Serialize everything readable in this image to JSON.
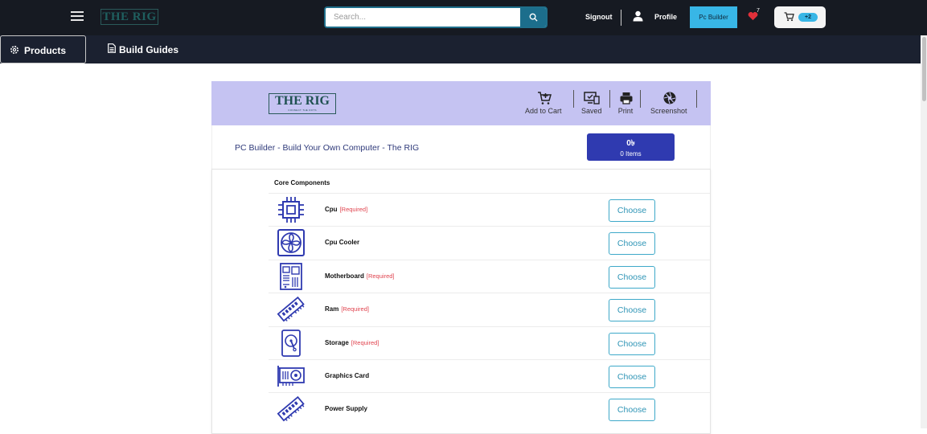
{
  "header": {
    "logo_text": "THE RIG",
    "search": {
      "placeholder": "Search..."
    },
    "signout_label": "Signout",
    "profile_label": "Profile",
    "pc_builder_label": "Pc Builder",
    "wishlist_count": "7",
    "cart_badge": "+2"
  },
  "nav": {
    "products_label": "Products",
    "build_guides_label": "Build Guides"
  },
  "builder": {
    "logo_text": "THE RIG",
    "logo_tagline": "CONNECT THE DOTS",
    "tools": [
      {
        "label": "Add to Cart",
        "icon": "cart-plus-icon"
      },
      {
        "label": "Saved",
        "icon": "saved-devices-icon"
      },
      {
        "label": "Print",
        "icon": "printer-icon"
      },
      {
        "label": "Screenshot",
        "icon": "camera-aperture-icon"
      }
    ],
    "title": "PC Builder - Build Your Own Computer - The RIG",
    "total_amount": "0৳",
    "total_items": "0 Items",
    "section_title": "Core Components",
    "components": [
      {
        "name": "Cpu",
        "required": "[Required]",
        "icon": "cpu-icon",
        "action": "Choose"
      },
      {
        "name": "Cpu Cooler",
        "required": "",
        "icon": "cpu-cooler-icon",
        "action": "Choose"
      },
      {
        "name": "Motherboard",
        "required": "[Required]",
        "icon": "motherboard-icon",
        "action": "Choose"
      },
      {
        "name": "Ram",
        "required": "[Required]",
        "icon": "ram-icon",
        "action": "Choose"
      },
      {
        "name": "Storage",
        "required": "[Required]",
        "icon": "storage-icon",
        "action": "Choose"
      },
      {
        "name": "Graphics Card",
        "required": "",
        "icon": "graphics-card-icon",
        "action": "Choose"
      },
      {
        "name": "Power Supply",
        "required": "",
        "icon": "power-supply-icon",
        "action": "Choose"
      }
    ]
  },
  "colors": {
    "topbar": "#161a22",
    "navbar": "#1b2130",
    "accent": "#38b6e6",
    "panel_header": "#c5c3f2",
    "total_box": "#2f3ab0",
    "required": "#e0434e",
    "icon_blue": "#2f3ab0"
  }
}
